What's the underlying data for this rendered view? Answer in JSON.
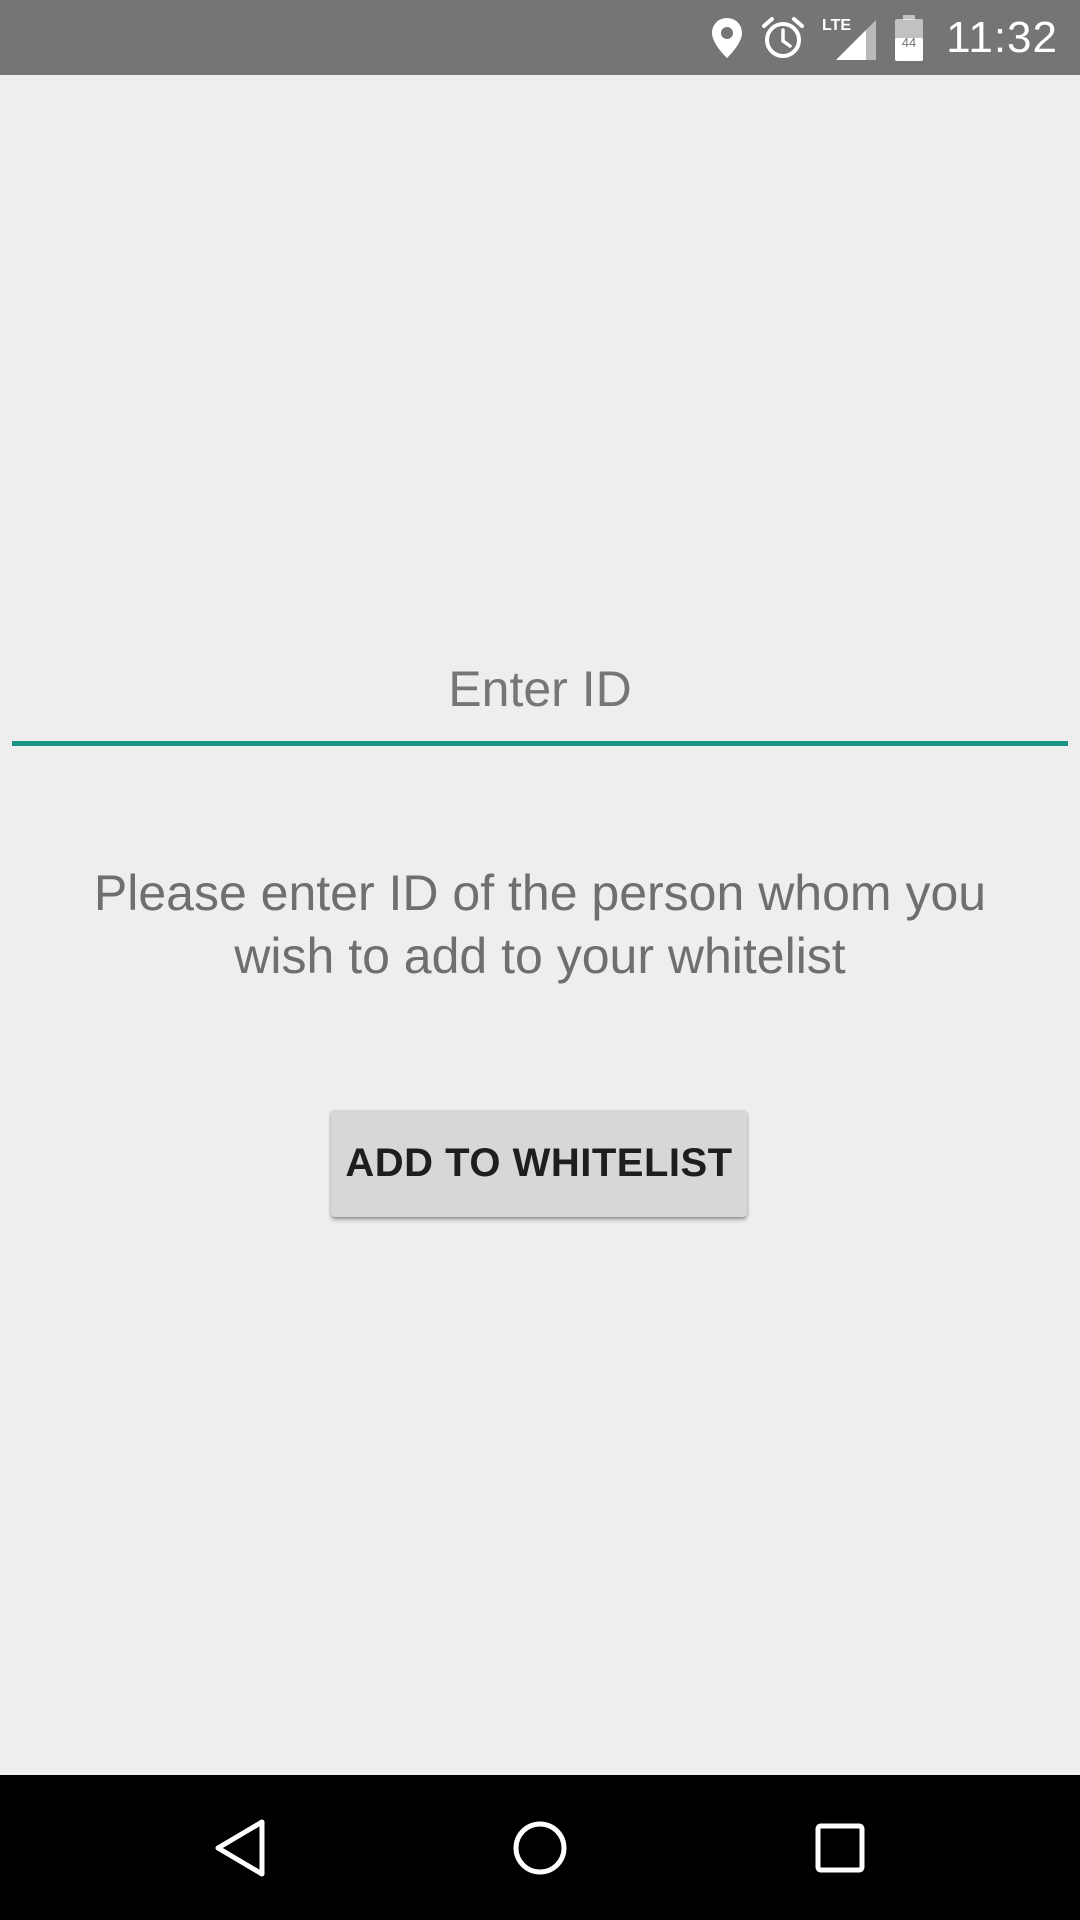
{
  "status_bar": {
    "time": "11:32",
    "network_label": "LTE",
    "battery_level_label": "44",
    "icons": [
      "location-icon",
      "alarm-icon",
      "lte-signal-icon",
      "battery-icon"
    ],
    "background_color": "#757575"
  },
  "main": {
    "id_input": {
      "placeholder": "Enter ID",
      "value": "",
      "underline_color": "#1a9485"
    },
    "instructions": "Please enter ID of the person whom you wish to add to your whitelist",
    "add_button_label": "ADD TO WHITELIST"
  },
  "navigation_bar": {
    "icons": [
      "back-icon",
      "home-icon",
      "recents-icon"
    ]
  }
}
